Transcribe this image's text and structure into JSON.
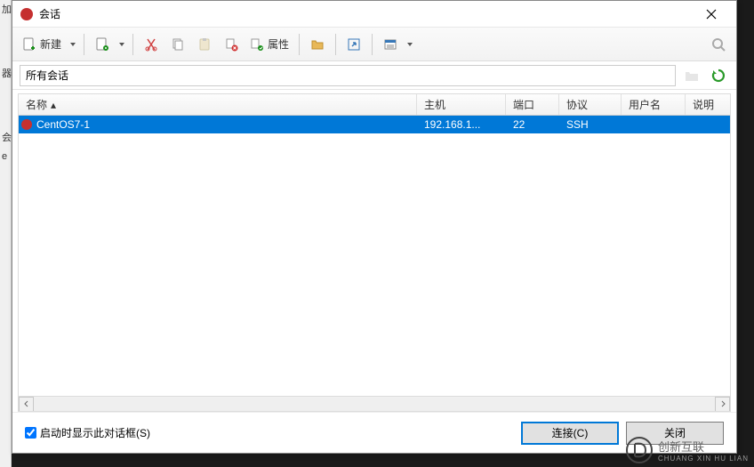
{
  "window": {
    "title": "会话"
  },
  "toolbar": {
    "new_label": "新建",
    "properties_label": "属性"
  },
  "search": {
    "value": "所有会话"
  },
  "columns": {
    "name": "名称",
    "host": "主机",
    "port": "端口",
    "protocol": "协议",
    "user": "用户名",
    "desc": "说明"
  },
  "rows": [
    {
      "name": "CentOS7-1",
      "host": "192.168.1...",
      "port": "22",
      "protocol": "SSH",
      "user": "",
      "desc": ""
    }
  ],
  "footer": {
    "show_on_start": "启动时显示此对话框(S)",
    "connect": "连接(C)",
    "close": "关闭"
  },
  "watermark": {
    "brand": "创新互联",
    "sub": "CHUANG XIN HU LIAN"
  },
  "left_strip": [
    "加",
    "器",
    "会",
    "e"
  ]
}
